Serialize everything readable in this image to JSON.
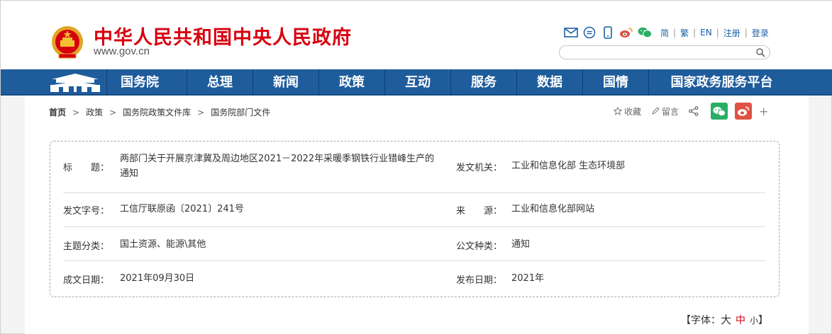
{
  "header": {
    "site_title": "中华人民共和国中央人民政府",
    "site_url": "www.gov.cn",
    "lang_links": [
      "简",
      "繁",
      "EN",
      "注册",
      "登录"
    ],
    "search_placeholder": ""
  },
  "nav": {
    "items": [
      "国务院",
      "总理",
      "新闻",
      "政策",
      "互动",
      "服务",
      "数据",
      "国情",
      "国家政务服务平台"
    ]
  },
  "breadcrumb": [
    "首页",
    "政策",
    "国务院政策文件库",
    "国务院部门文件"
  ],
  "actions": {
    "favorite": "收藏",
    "comment": "留言"
  },
  "doc_info": {
    "title_label": "标　　题：",
    "title_line1": "两部门关于开展京津冀及周边地区2021－2022年采暖季钢铁行业错峰生产的",
    "title_line2": "通知",
    "issuer_label": "发文机关：",
    "issuer_value": "工业和信息化部 生态环境部",
    "docno_label": "发文字号：",
    "docno_value": "工信厅联原函〔2021〕241号",
    "source_label": "来　　源：",
    "source_value": "工业和信息化部网站",
    "topic_label": "主题分类：",
    "topic_value": "国土资源、能源\\其他",
    "type_label": "公文种类：",
    "type_value": "通知",
    "written_label": "成文日期：",
    "written_value": "2021年09月30日",
    "publish_label": "发布日期：",
    "publish_value": "2021年"
  },
  "font_size": {
    "prefix": "【字体：",
    "large": "大",
    "medium": "中",
    "small": "小",
    "suffix": "】"
  },
  "colors": {
    "brand_red": "#d7000f",
    "nav_blue": "#1e5c9c",
    "wechat_green": "#2aae67",
    "weibo_red": "#e05244"
  }
}
